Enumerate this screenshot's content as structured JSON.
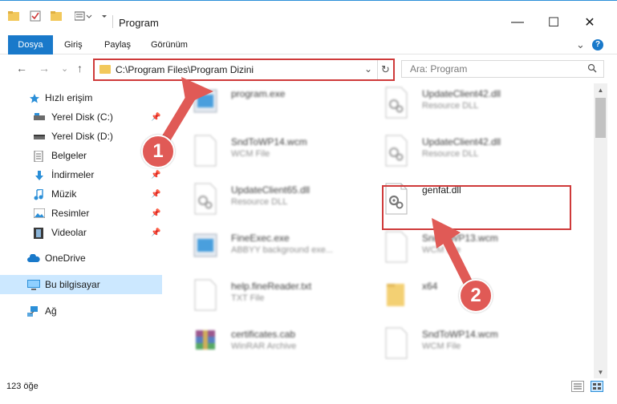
{
  "window": {
    "title": "Program",
    "minimize": "—",
    "maximize": "☐",
    "close": "✕"
  },
  "ribbon": {
    "tabs": [
      "Dosya",
      "Giriş",
      "Paylaş",
      "Görünüm"
    ],
    "expand": "⌄",
    "help": "?"
  },
  "address": {
    "path": "C:\\Program Files\\Program Dizini",
    "chevron": "⌄",
    "refresh": "↻"
  },
  "search": {
    "placeholder": "Ara: Program",
    "icon": "search-icon"
  },
  "nav": {
    "back": "←",
    "forward": "→",
    "recent": "⌄",
    "up": "↑"
  },
  "sidebar": {
    "items": [
      {
        "label": "Hızlı erişim",
        "icon": "star-icon",
        "pinned": false
      },
      {
        "label": "Yerel Disk (C:)",
        "icon": "drive-icon",
        "pinned": true
      },
      {
        "label": "Yerel Disk (D:)",
        "icon": "drive-icon",
        "pinned": false
      },
      {
        "label": "Belgeler",
        "icon": "documents-icon",
        "pinned": true
      },
      {
        "label": "İndirmeler",
        "icon": "download-icon",
        "pinned": true
      },
      {
        "label": "Müzik",
        "icon": "music-icon",
        "pinned": true
      },
      {
        "label": "Resimler",
        "icon": "pictures-icon",
        "pinned": true
      },
      {
        "label": "Videolar",
        "icon": "videos-icon",
        "pinned": true
      },
      {
        "label": "OneDrive",
        "icon": "cloud-icon",
        "pinned": false
      },
      {
        "label": "Bu bilgisayar",
        "icon": "computer-icon",
        "pinned": false,
        "selected": true
      },
      {
        "label": "Ağ",
        "icon": "network-icon",
        "pinned": false
      }
    ]
  },
  "files": [
    {
      "name": "program.exe",
      "type": "",
      "icon": "exe-icon"
    },
    {
      "name": "UpdateClient42.dll",
      "type": "Resource DLL",
      "icon": "dll-icon"
    },
    {
      "name": "SndToWP14.wcm",
      "type": "WCM File",
      "icon": "file-icon"
    },
    {
      "name": "UpdateClient42.dll",
      "type": "Resource DLL",
      "icon": "dll-icon"
    },
    {
      "name": "UpdateClient65.dll",
      "type": "Resource DLL",
      "icon": "dll-icon"
    },
    {
      "name": "genfat.dll",
      "type": "",
      "icon": "dll-icon",
      "highlighted": true
    },
    {
      "name": "FineExec.exe",
      "type": "ABBYY background exe...",
      "icon": "exe-icon"
    },
    {
      "name": "SndToWP13.wcm",
      "type": "WCM File",
      "icon": "file-icon"
    },
    {
      "name": "help.fineReader.txt",
      "type": "TXT File",
      "icon": "file-icon"
    },
    {
      "name": "x64",
      "type": "",
      "icon": "folder-icon"
    },
    {
      "name": "certificates.cab",
      "type": "WinRAR Archive",
      "icon": "archive-icon"
    },
    {
      "name": "SndToWP14.wcm",
      "type": "WCM File",
      "icon": "file-icon"
    }
  ],
  "status": {
    "count": "123 öğe"
  },
  "markers": [
    "1",
    "2"
  ],
  "colors": {
    "accent": "#1979ca",
    "highlight": "#cf3a3a",
    "marker": "#e05a56",
    "selection": "#cce8ff"
  }
}
